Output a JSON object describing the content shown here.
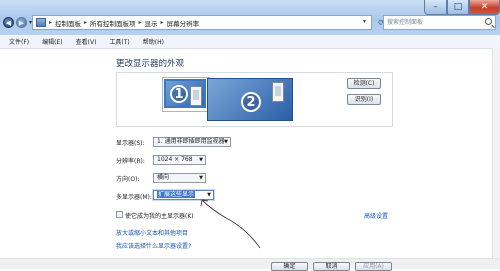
{
  "window": {
    "minimize_glyph": "–",
    "maximize_glyph": "□",
    "close_glyph": "✕"
  },
  "nav": {
    "back_glyph": "◀",
    "forward_glyph": "▶",
    "dropdown_glyph": "▾"
  },
  "address": {
    "crumbs": [
      "控制面板",
      "所有控制面板项",
      "显示",
      "屏幕分辨率"
    ],
    "separator": "▸",
    "dropdown_glyph": "▾",
    "refresh_glyph": "⟳"
  },
  "search": {
    "placeholder": "搜索控制面板"
  },
  "menu": [
    "文件(F)",
    "编辑(E)",
    "查看(V)",
    "工具(T)",
    "帮助(H)"
  ],
  "page": {
    "heading": "更改显示器的外观"
  },
  "monitors": [
    {
      "number": "1",
      "selected": true
    },
    {
      "number": "2",
      "selected": false
    }
  ],
  "buttons": {
    "detect": "检测(C)",
    "identify": "识别(I)",
    "ok": "确定",
    "cancel": "取消",
    "apply": "应用(A)"
  },
  "settings": [
    {
      "label": "显示器(S):",
      "value": "1. 通用非即插即用监视器"
    },
    {
      "label": "分辨率(R):",
      "value": "1024 × 768"
    },
    {
      "label": "方向(O):",
      "value": "横向"
    },
    {
      "label": "多显示器(M):",
      "value": "扩展这些显示"
    }
  ],
  "checkbox": {
    "label": "使它成为我的主显示器(K)",
    "checked": false
  },
  "links": {
    "advanced": "高级设置",
    "text_size": "放大或缩小文本和其他项目",
    "which_settings": "我应该选择什么显示器设置?"
  },
  "colors": {
    "accent": "#3d77bf",
    "link": "#1a55b8",
    "titlebar": "#b6d2ef"
  }
}
